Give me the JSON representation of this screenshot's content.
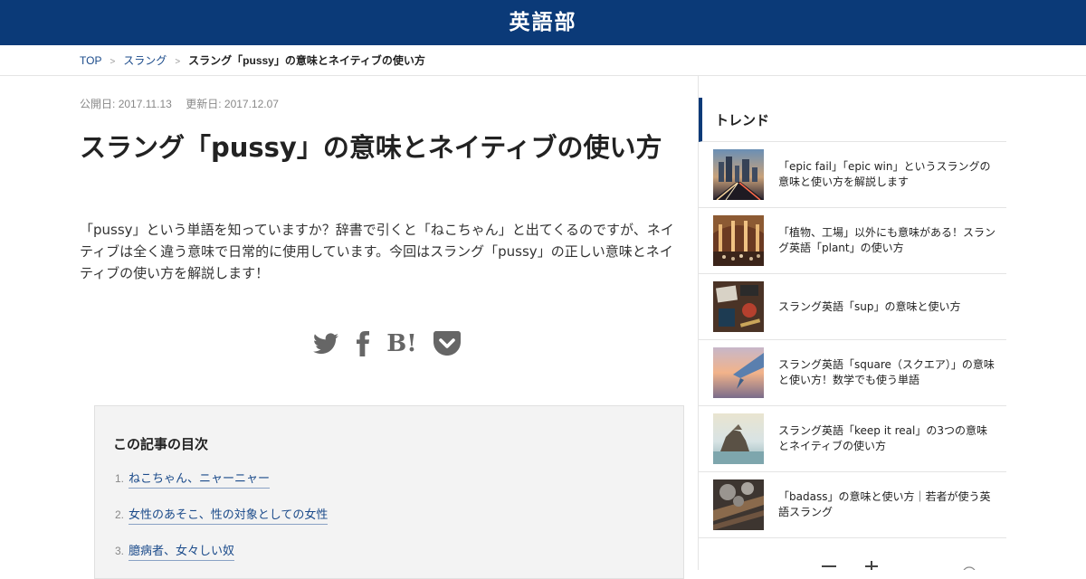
{
  "header": {
    "logo": "英語部",
    "bg_color": "#0b3a78"
  },
  "breadcrumb": {
    "home": "TOP",
    "category": "スラング",
    "current": "スラング「pussy」の意味とネイティブの使い方",
    "separator": ">"
  },
  "article": {
    "published_label": "公開日:",
    "published": "2017.11.13",
    "updated_label": "更新日:",
    "updated": "2017.12.07",
    "title": "スラング「pussy」の意味とネイティブの使い方",
    "lead": "「pussy」という単語を知っていますか？辞書で引くと「ねこちゃん」と出てくるのですが、ネイティブは全く違う意味で日常的に使用しています。今回はスラング「pussy」の正しい意味とネイティブの使い方を解説します！",
    "share": [
      {
        "name": "twitter-icon"
      },
      {
        "name": "facebook-icon"
      },
      {
        "name": "hatena-bookmark-icon",
        "text": "B!"
      },
      {
        "name": "pocket-icon"
      }
    ],
    "toc": {
      "title": "この記事の目次",
      "items": [
        {
          "num": "1.",
          "label": "ねこちゃん、ニャーニャー"
        },
        {
          "num": "2.",
          "label": "女性のあそこ、性の対象としての女性"
        },
        {
          "num": "3.",
          "label": "臆病者、女々しい奴"
        }
      ]
    }
  },
  "sidebar": {
    "trend_title": "トレンド",
    "items": [
      {
        "title": "「epic fail」「epic win」というスラングの意味と使い方を解説します",
        "thumb": "city-highway"
      },
      {
        "title": "「植物、工場」以外にも意味がある！スラング英語「plant」の使い方",
        "thumb": "station-hall"
      },
      {
        "title": "スラング英語「sup」の意味と使い方",
        "thumb": "desk-items"
      },
      {
        "title": "スラング英語「square（スクエア）」の意味と使い方！数学でも使う単語",
        "thumb": "airplane-wing"
      },
      {
        "title": "スラング英語「keep it real」の3つの意味とネイティブの使い方",
        "thumb": "sea-rock"
      },
      {
        "title": "「badass」の意味と使い方｜若者が使う英語スラング",
        "thumb": "wood-ash"
      }
    ]
  }
}
